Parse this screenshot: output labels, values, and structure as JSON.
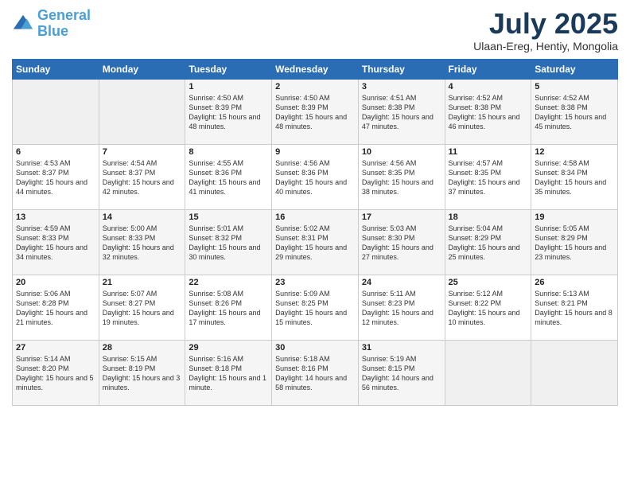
{
  "logo": {
    "line1": "General",
    "line2": "Blue"
  },
  "title": "July 2025",
  "location": "Ulaan-Ereg, Hentiy, Mongolia",
  "weekdays": [
    "Sunday",
    "Monday",
    "Tuesday",
    "Wednesday",
    "Thursday",
    "Friday",
    "Saturday"
  ],
  "weeks": [
    [
      {
        "day": "",
        "sunrise": "",
        "sunset": "",
        "daylight": ""
      },
      {
        "day": "",
        "sunrise": "",
        "sunset": "",
        "daylight": ""
      },
      {
        "day": "1",
        "sunrise": "Sunrise: 4:50 AM",
        "sunset": "Sunset: 8:39 PM",
        "daylight": "Daylight: 15 hours and 48 minutes."
      },
      {
        "day": "2",
        "sunrise": "Sunrise: 4:50 AM",
        "sunset": "Sunset: 8:39 PM",
        "daylight": "Daylight: 15 hours and 48 minutes."
      },
      {
        "day": "3",
        "sunrise": "Sunrise: 4:51 AM",
        "sunset": "Sunset: 8:38 PM",
        "daylight": "Daylight: 15 hours and 47 minutes."
      },
      {
        "day": "4",
        "sunrise": "Sunrise: 4:52 AM",
        "sunset": "Sunset: 8:38 PM",
        "daylight": "Daylight: 15 hours and 46 minutes."
      },
      {
        "day": "5",
        "sunrise": "Sunrise: 4:52 AM",
        "sunset": "Sunset: 8:38 PM",
        "daylight": "Daylight: 15 hours and 45 minutes."
      }
    ],
    [
      {
        "day": "6",
        "sunrise": "Sunrise: 4:53 AM",
        "sunset": "Sunset: 8:37 PM",
        "daylight": "Daylight: 15 hours and 44 minutes."
      },
      {
        "day": "7",
        "sunrise": "Sunrise: 4:54 AM",
        "sunset": "Sunset: 8:37 PM",
        "daylight": "Daylight: 15 hours and 42 minutes."
      },
      {
        "day": "8",
        "sunrise": "Sunrise: 4:55 AM",
        "sunset": "Sunset: 8:36 PM",
        "daylight": "Daylight: 15 hours and 41 minutes."
      },
      {
        "day": "9",
        "sunrise": "Sunrise: 4:56 AM",
        "sunset": "Sunset: 8:36 PM",
        "daylight": "Daylight: 15 hours and 40 minutes."
      },
      {
        "day": "10",
        "sunrise": "Sunrise: 4:56 AM",
        "sunset": "Sunset: 8:35 PM",
        "daylight": "Daylight: 15 hours and 38 minutes."
      },
      {
        "day": "11",
        "sunrise": "Sunrise: 4:57 AM",
        "sunset": "Sunset: 8:35 PM",
        "daylight": "Daylight: 15 hours and 37 minutes."
      },
      {
        "day": "12",
        "sunrise": "Sunrise: 4:58 AM",
        "sunset": "Sunset: 8:34 PM",
        "daylight": "Daylight: 15 hours and 35 minutes."
      }
    ],
    [
      {
        "day": "13",
        "sunrise": "Sunrise: 4:59 AM",
        "sunset": "Sunset: 8:33 PM",
        "daylight": "Daylight: 15 hours and 34 minutes."
      },
      {
        "day": "14",
        "sunrise": "Sunrise: 5:00 AM",
        "sunset": "Sunset: 8:33 PM",
        "daylight": "Daylight: 15 hours and 32 minutes."
      },
      {
        "day": "15",
        "sunrise": "Sunrise: 5:01 AM",
        "sunset": "Sunset: 8:32 PM",
        "daylight": "Daylight: 15 hours and 30 minutes."
      },
      {
        "day": "16",
        "sunrise": "Sunrise: 5:02 AM",
        "sunset": "Sunset: 8:31 PM",
        "daylight": "Daylight: 15 hours and 29 minutes."
      },
      {
        "day": "17",
        "sunrise": "Sunrise: 5:03 AM",
        "sunset": "Sunset: 8:30 PM",
        "daylight": "Daylight: 15 hours and 27 minutes."
      },
      {
        "day": "18",
        "sunrise": "Sunrise: 5:04 AM",
        "sunset": "Sunset: 8:29 PM",
        "daylight": "Daylight: 15 hours and 25 minutes."
      },
      {
        "day": "19",
        "sunrise": "Sunrise: 5:05 AM",
        "sunset": "Sunset: 8:29 PM",
        "daylight": "Daylight: 15 hours and 23 minutes."
      }
    ],
    [
      {
        "day": "20",
        "sunrise": "Sunrise: 5:06 AM",
        "sunset": "Sunset: 8:28 PM",
        "daylight": "Daylight: 15 hours and 21 minutes."
      },
      {
        "day": "21",
        "sunrise": "Sunrise: 5:07 AM",
        "sunset": "Sunset: 8:27 PM",
        "daylight": "Daylight: 15 hours and 19 minutes."
      },
      {
        "day": "22",
        "sunrise": "Sunrise: 5:08 AM",
        "sunset": "Sunset: 8:26 PM",
        "daylight": "Daylight: 15 hours and 17 minutes."
      },
      {
        "day": "23",
        "sunrise": "Sunrise: 5:09 AM",
        "sunset": "Sunset: 8:25 PM",
        "daylight": "Daylight: 15 hours and 15 minutes."
      },
      {
        "day": "24",
        "sunrise": "Sunrise: 5:11 AM",
        "sunset": "Sunset: 8:23 PM",
        "daylight": "Daylight: 15 hours and 12 minutes."
      },
      {
        "day": "25",
        "sunrise": "Sunrise: 5:12 AM",
        "sunset": "Sunset: 8:22 PM",
        "daylight": "Daylight: 15 hours and 10 minutes."
      },
      {
        "day": "26",
        "sunrise": "Sunrise: 5:13 AM",
        "sunset": "Sunset: 8:21 PM",
        "daylight": "Daylight: 15 hours and 8 minutes."
      }
    ],
    [
      {
        "day": "27",
        "sunrise": "Sunrise: 5:14 AM",
        "sunset": "Sunset: 8:20 PM",
        "daylight": "Daylight: 15 hours and 5 minutes."
      },
      {
        "day": "28",
        "sunrise": "Sunrise: 5:15 AM",
        "sunset": "Sunset: 8:19 PM",
        "daylight": "Daylight: 15 hours and 3 minutes."
      },
      {
        "day": "29",
        "sunrise": "Sunrise: 5:16 AM",
        "sunset": "Sunset: 8:18 PM",
        "daylight": "Daylight: 15 hours and 1 minute."
      },
      {
        "day": "30",
        "sunrise": "Sunrise: 5:18 AM",
        "sunset": "Sunset: 8:16 PM",
        "daylight": "Daylight: 14 hours and 58 minutes."
      },
      {
        "day": "31",
        "sunrise": "Sunrise: 5:19 AM",
        "sunset": "Sunset: 8:15 PM",
        "daylight": "Daylight: 14 hours and 56 minutes."
      },
      {
        "day": "",
        "sunrise": "",
        "sunset": "",
        "daylight": ""
      },
      {
        "day": "",
        "sunrise": "",
        "sunset": "",
        "daylight": ""
      }
    ]
  ]
}
